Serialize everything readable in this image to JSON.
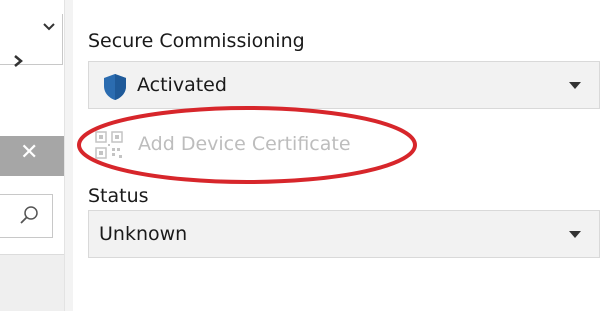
{
  "left_pane": {
    "close_glyph": "✕"
  },
  "secure_commissioning": {
    "label": "Secure Commissioning",
    "selected_value": "Activated",
    "icon": "shield-icon"
  },
  "add_device_certificate": {
    "label": "Add Device Certificate",
    "enabled": false,
    "icon": "qr-code-icon"
  },
  "status": {
    "label": "Status",
    "selected_value": "Unknown"
  },
  "colors": {
    "shield": "#2b6cb0",
    "highlight_ring": "#d7262b",
    "disabled_text": "#bdbdbd",
    "select_background": "#f2f2f2"
  }
}
